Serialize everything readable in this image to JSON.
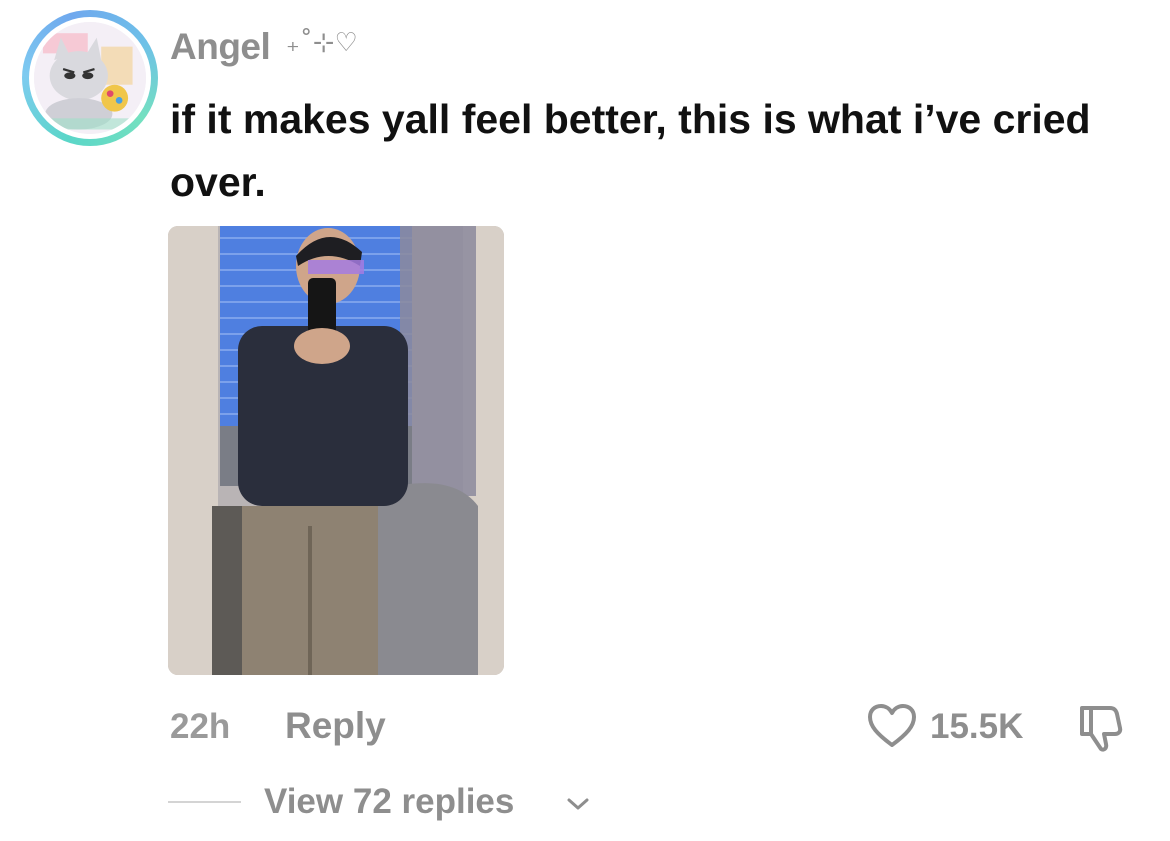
{
  "comment": {
    "username": "Angel",
    "username_decoration": "₊˚⊹♡",
    "text": "if it makes yall feel better, this is what i’ve cried over.",
    "time": "22h",
    "reply_label": "Reply",
    "like_count": "15.5K",
    "view_replies_label": "View 72 replies"
  },
  "icons": {
    "like": "heart-outline-icon",
    "dislike": "thumbs-down-icon",
    "expand": "chevron-down-icon"
  },
  "colors": {
    "muted_text": "#8e8e8e",
    "body_text": "#111111",
    "avatar_ring": "#5ad6c8"
  }
}
